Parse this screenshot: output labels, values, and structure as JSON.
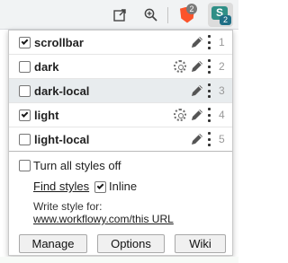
{
  "toolbar": {
    "icons": [
      "open-in-new-icon",
      "zoom-in-icon",
      "brave-shield-icon",
      "stylus-icon"
    ],
    "brave_badge": "2",
    "stylus_count": "2",
    "stylus_letter": "S",
    "colors": {
      "brave": "#fb542b",
      "stylus": "#2f8f86"
    }
  },
  "styles": [
    {
      "name": "scrollbar",
      "enabled": true,
      "has_settings": false,
      "number": "1"
    },
    {
      "name": "dark",
      "enabled": false,
      "has_settings": true,
      "number": "2"
    },
    {
      "name": "dark-local",
      "enabled": false,
      "has_settings": false,
      "number": "3"
    },
    {
      "name": "light",
      "enabled": true,
      "has_settings": true,
      "number": "4"
    },
    {
      "name": "light-local",
      "enabled": false,
      "has_settings": false,
      "number": "5"
    }
  ],
  "options": {
    "turn_all_off": "Turn all styles off",
    "turn_all_off_checked": false,
    "find_styles": "Find styles",
    "inline": "Inline",
    "inline_checked": true
  },
  "write_style": {
    "label": "Write style for:",
    "url": "www.workflowy.com/this URL"
  },
  "buttons": {
    "manage": "Manage",
    "options": "Options",
    "wiki": "Wiki"
  }
}
